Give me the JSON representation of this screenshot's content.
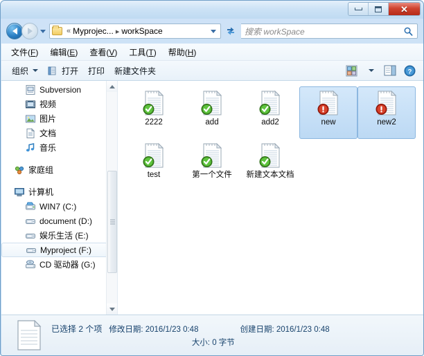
{
  "window": {
    "controls": {
      "minimize": "Minimize",
      "maximize": "Maximize",
      "close": "✕"
    }
  },
  "address": {
    "back_tooltip": "后退",
    "forward_tooltip": "前进",
    "path_root": "«",
    "path_parent": "Myprojec...",
    "path_separator": "▸",
    "path_current": "workSpace",
    "refresh_tooltip": "刷新"
  },
  "search": {
    "placeholder": "搜索 workSpace"
  },
  "menubar": {
    "items": [
      {
        "label": "文件",
        "accel": "F"
      },
      {
        "label": "编辑",
        "accel": "E"
      },
      {
        "label": "查看",
        "accel": "V"
      },
      {
        "label": "工具",
        "accel": "T"
      },
      {
        "label": "帮助",
        "accel": "H"
      }
    ]
  },
  "toolbar": {
    "organize": "组织",
    "open": "打开",
    "print": "打印",
    "new_folder": "新建文件夹",
    "view_tooltip": "更改您的视图",
    "preview_tooltip": "显示预览窗格",
    "help_tooltip": "获取帮助"
  },
  "sidebar": {
    "items": [
      {
        "label": "Subversion",
        "icon": "subversion-icon",
        "level": "child",
        "selected": false
      },
      {
        "label": "视频",
        "icon": "video-icon",
        "level": "child",
        "selected": false
      },
      {
        "label": "图片",
        "icon": "pictures-icon",
        "level": "child",
        "selected": false
      },
      {
        "label": "文档",
        "icon": "documents-icon",
        "level": "child",
        "selected": false
      },
      {
        "label": "音乐",
        "icon": "music-icon",
        "level": "child",
        "selected": false
      },
      {
        "label": "家庭组",
        "icon": "homegroup-icon",
        "level": "root",
        "selected": false
      },
      {
        "label": "计算机",
        "icon": "computer-icon",
        "level": "root",
        "selected": false
      },
      {
        "label": "WIN7 (C:)",
        "icon": "system-drive-icon",
        "level": "child",
        "selected": false
      },
      {
        "label": "document (D:)",
        "icon": "drive-icon",
        "level": "child",
        "selected": false
      },
      {
        "label": "娱乐生活  (E:)",
        "icon": "drive-icon",
        "level": "child",
        "selected": false
      },
      {
        "label": "Myproject (F:)",
        "icon": "drive-icon",
        "level": "child",
        "selected": true
      },
      {
        "label": "CD 驱动器 (G:)",
        "icon": "cd-drive-icon",
        "level": "child",
        "selected": false
      }
    ]
  },
  "files": [
    {
      "name": "2222",
      "status": "committed",
      "selected": false
    },
    {
      "name": "add",
      "status": "committed",
      "selected": false
    },
    {
      "name": "add2",
      "status": "committed",
      "selected": false
    },
    {
      "name": "new",
      "status": "modified",
      "selected": true
    },
    {
      "name": "new2",
      "status": "modified",
      "selected": true
    },
    {
      "name": "test",
      "status": "committed",
      "selected": false
    },
    {
      "name": "第一个文件",
      "status": "committed",
      "selected": false
    },
    {
      "name": "新建文本文档",
      "status": "committed",
      "selected": false
    }
  ],
  "details": {
    "selection": "已选择 2 个项",
    "modified_date": "修改日期: 2016/1/23 0:48",
    "created_date": "创建日期: 2016/1/23 0:48",
    "size": "大小: 0 字节"
  },
  "colors": {
    "accent_blue": "#2a7fc4",
    "selection_blue": "#bcd9f4",
    "status_ok_green": "#4fa832",
    "status_modified_red": "#c12b1c",
    "close_red": "#cf4430"
  }
}
